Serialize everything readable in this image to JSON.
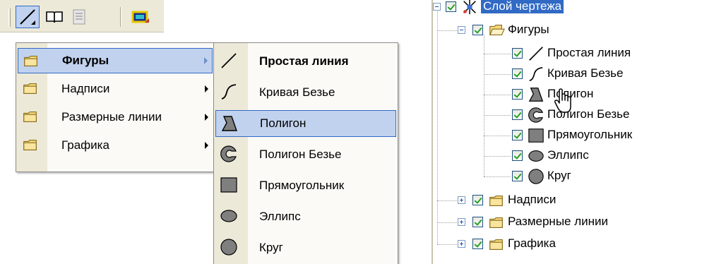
{
  "toolbar": {
    "buttons": [
      {
        "icon": "line-tool-icon",
        "pressed": true
      },
      {
        "icon": "book-icon",
        "pressed": false
      },
      {
        "icon": "page-icon",
        "pressed": false
      },
      {
        "icon": "layer-color-icon",
        "pressed": false
      }
    ]
  },
  "main_menu": {
    "items": [
      {
        "label": "Фигуры",
        "icon": "folder-icon",
        "highlighted": true,
        "bold": true,
        "has_submenu": true
      },
      {
        "label": "Надписи",
        "icon": "folder-icon",
        "highlighted": false,
        "bold": false,
        "has_submenu": true
      },
      {
        "label": "Размерные линии",
        "icon": "folder-icon",
        "highlighted": false,
        "bold": false,
        "has_submenu": true
      },
      {
        "label": "Графика",
        "icon": "folder-icon",
        "highlighted": false,
        "bold": false,
        "has_submenu": true
      }
    ]
  },
  "shapes_submenu": {
    "items": [
      {
        "label": "Простая линия",
        "icon": "line-icon",
        "bold": true,
        "highlighted": false
      },
      {
        "label": "Кривая Безье",
        "icon": "bezier-curve-icon",
        "bold": false,
        "highlighted": false
      },
      {
        "label": "Полигон",
        "icon": "polygon-icon",
        "bold": false,
        "highlighted": true
      },
      {
        "label": "Полигон Безье",
        "icon": "bezier-polygon-icon",
        "bold": false,
        "highlighted": false
      },
      {
        "label": "Прямоугольник",
        "icon": "rectangle-icon",
        "bold": false,
        "highlighted": false
      },
      {
        "label": "Эллипс",
        "icon": "ellipse-icon",
        "bold": false,
        "highlighted": false
      },
      {
        "label": "Круг",
        "icon": "circle-icon",
        "bold": false,
        "highlighted": false
      }
    ]
  },
  "layer_tree": {
    "root": {
      "label": "Слой чертежа",
      "icon": "layer-icon",
      "selected": true,
      "checked": true
    },
    "groups": [
      {
        "label": "Фигуры",
        "icon": "open-folder-icon",
        "checked": true,
        "expanded": true,
        "children": [
          {
            "label": "Простая линия",
            "icon": "line-icon",
            "checked": true
          },
          {
            "label": "Кривая Безье",
            "icon": "bezier-curve-icon",
            "checked": true
          },
          {
            "label": "Полигон",
            "icon": "polygon-icon",
            "checked": true
          },
          {
            "label": "Полигон Безье",
            "icon": "bezier-polygon-icon",
            "checked": true
          },
          {
            "label": "Прямоугольник",
            "icon": "rectangle-icon",
            "checked": true
          },
          {
            "label": "Эллипс",
            "icon": "ellipse-icon",
            "checked": true
          },
          {
            "label": "Круг",
            "icon": "circle-icon",
            "checked": true
          }
        ]
      },
      {
        "label": "Надписи",
        "icon": "folder-icon",
        "checked": true,
        "expanded": false
      },
      {
        "label": "Размерные линии",
        "icon": "folder-icon",
        "checked": true,
        "expanded": false
      },
      {
        "label": "Графика",
        "icon": "folder-icon",
        "checked": true,
        "expanded": false
      }
    ]
  },
  "colors": {
    "highlight_fill": "#c1d2ee",
    "highlight_border": "#316ac5",
    "selection": "#316ac5",
    "menu_gutter": "#ece9d8",
    "toolbar": "#ece9d8",
    "folder": "#f5d77a",
    "shape_gray": "#7f7f7f"
  }
}
